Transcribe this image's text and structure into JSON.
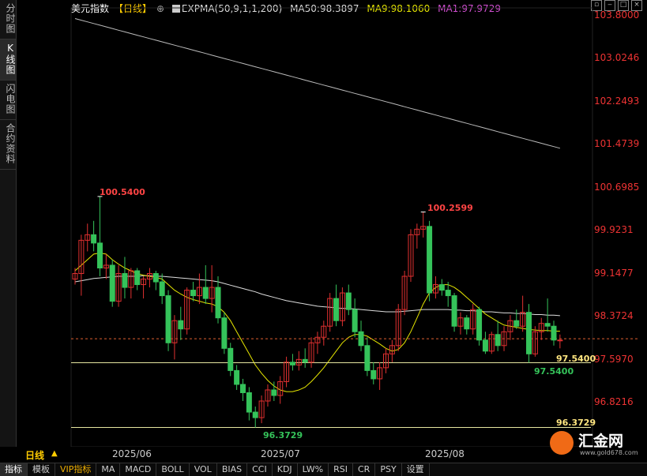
{
  "side_tabs": [
    "分时图",
    "K线图",
    "闪电图",
    "合约资料"
  ],
  "header": {
    "title": "美元指数",
    "period_tag": "【日线】",
    "plus_icon": "⊕",
    "expma": "EXPMA(50,9,1,1,200)",
    "ma50": "MA50:98.3897",
    "ma9": "MA9:98.1060",
    "ma1": "MA1:97.9729"
  },
  "window_buttons": [
    "restore-icon",
    "minimize-icon",
    "maximize-icon",
    "close-icon"
  ],
  "colors": {
    "up": "#e03030",
    "down": "#35c35a",
    "ma50": "#dddddd",
    "ma9": "#e6e600",
    "ma200": "#bbbbbb",
    "axis_text": "#e33333"
  },
  "chart_data": {
    "type": "candlestick",
    "y_ticks": [
      "103.8000",
      "103.0246",
      "102.2493",
      "101.4739",
      "100.6985",
      "99.9231",
      "99.1477",
      "98.3724",
      "97.5970",
      "96.8216"
    ],
    "ylim": [
      96.25,
      103.8
    ],
    "x_labels": [
      "2025/06",
      "2025/07",
      "2025/08"
    ],
    "period": "日线",
    "annotations": {
      "high1": "100.5400",
      "high2": "100.2599",
      "low_main": "96.3729",
      "low_main_right": "96.3729",
      "recent_low": "97.5400",
      "recent_low_right": "97.5400"
    },
    "candles": [
      {
        "o": 99.05,
        "h": 99.25,
        "l": 98.95,
        "c": 99.15
      },
      {
        "o": 99.15,
        "h": 99.85,
        "l": 98.75,
        "c": 99.75
      },
      {
        "o": 99.75,
        "h": 100.05,
        "l": 99.55,
        "c": 99.85
      },
      {
        "o": 99.85,
        "h": 100.1,
        "l": 99.55,
        "c": 99.7
      },
      {
        "o": 99.7,
        "h": 100.54,
        "l": 99.1,
        "c": 99.25
      },
      {
        "o": 99.25,
        "h": 99.5,
        "l": 99.05,
        "c": 99.3
      },
      {
        "o": 99.3,
        "h": 99.4,
        "l": 98.55,
        "c": 98.65
      },
      {
        "o": 98.65,
        "h": 99.3,
        "l": 98.55,
        "c": 99.15
      },
      {
        "o": 99.15,
        "h": 99.45,
        "l": 98.7,
        "c": 98.9
      },
      {
        "o": 98.9,
        "h": 99.25,
        "l": 98.7,
        "c": 99.2
      },
      {
        "o": 99.2,
        "h": 99.25,
        "l": 98.85,
        "c": 98.95
      },
      {
        "o": 98.95,
        "h": 99.1,
        "l": 98.7,
        "c": 99.05
      },
      {
        "o": 99.05,
        "h": 99.25,
        "l": 98.9,
        "c": 99.15
      },
      {
        "o": 99.15,
        "h": 99.2,
        "l": 98.85,
        "c": 99.0
      },
      {
        "o": 99.0,
        "h": 99.15,
        "l": 98.6,
        "c": 98.75
      },
      {
        "o": 98.75,
        "h": 98.85,
        "l": 97.75,
        "c": 97.9
      },
      {
        "o": 97.9,
        "h": 98.4,
        "l": 97.6,
        "c": 98.3
      },
      {
        "o": 98.3,
        "h": 98.55,
        "l": 97.95,
        "c": 98.15
      },
      {
        "o": 98.15,
        "h": 98.9,
        "l": 98.05,
        "c": 98.85
      },
      {
        "o": 98.85,
        "h": 99.0,
        "l": 98.65,
        "c": 98.75
      },
      {
        "o": 98.75,
        "h": 99.15,
        "l": 98.6,
        "c": 98.9
      },
      {
        "o": 98.9,
        "h": 99.3,
        "l": 98.6,
        "c": 98.7
      },
      {
        "o": 98.7,
        "h": 99.3,
        "l": 98.45,
        "c": 98.9
      },
      {
        "o": 98.9,
        "h": 99.1,
        "l": 98.25,
        "c": 98.35
      },
      {
        "o": 98.35,
        "h": 98.45,
        "l": 97.7,
        "c": 97.8
      },
      {
        "o": 97.8,
        "h": 97.9,
        "l": 97.3,
        "c": 97.4
      },
      {
        "o": 97.4,
        "h": 97.5,
        "l": 97.05,
        "c": 97.15
      },
      {
        "o": 97.15,
        "h": 97.25,
        "l": 96.85,
        "c": 97.0
      },
      {
        "o": 97.0,
        "h": 97.1,
        "l": 96.5,
        "c": 96.65
      },
      {
        "o": 96.65,
        "h": 96.75,
        "l": 96.37,
        "c": 96.55
      },
      {
        "o": 96.55,
        "h": 96.95,
        "l": 96.45,
        "c": 96.85
      },
      {
        "o": 96.85,
        "h": 97.15,
        "l": 96.75,
        "c": 97.05
      },
      {
        "o": 97.05,
        "h": 97.2,
        "l": 96.85,
        "c": 96.95
      },
      {
        "o": 96.95,
        "h": 97.3,
        "l": 96.8,
        "c": 97.2
      },
      {
        "o": 97.2,
        "h": 97.65,
        "l": 97.1,
        "c": 97.55
      },
      {
        "o": 97.55,
        "h": 97.7,
        "l": 97.4,
        "c": 97.5
      },
      {
        "o": 97.5,
        "h": 97.75,
        "l": 97.4,
        "c": 97.6
      },
      {
        "o": 97.6,
        "h": 97.8,
        "l": 97.45,
        "c": 97.55
      },
      {
        "o": 97.55,
        "h": 98.0,
        "l": 97.45,
        "c": 97.9
      },
      {
        "o": 97.9,
        "h": 98.1,
        "l": 97.7,
        "c": 98.0
      },
      {
        "o": 98.0,
        "h": 98.3,
        "l": 97.85,
        "c": 98.2
      },
      {
        "o": 98.2,
        "h": 98.8,
        "l": 98.1,
        "c": 98.7
      },
      {
        "o": 98.7,
        "h": 98.95,
        "l": 98.2,
        "c": 98.3
      },
      {
        "o": 98.3,
        "h": 98.9,
        "l": 98.2,
        "c": 98.8
      },
      {
        "o": 98.8,
        "h": 98.95,
        "l": 98.4,
        "c": 98.5
      },
      {
        "o": 98.5,
        "h": 98.7,
        "l": 98.0,
        "c": 98.1
      },
      {
        "o": 98.1,
        "h": 98.3,
        "l": 97.75,
        "c": 97.85
      },
      {
        "o": 97.85,
        "h": 98.0,
        "l": 97.3,
        "c": 97.4
      },
      {
        "o": 97.4,
        "h": 97.55,
        "l": 97.15,
        "c": 97.25
      },
      {
        "o": 97.25,
        "h": 97.55,
        "l": 97.05,
        "c": 97.45
      },
      {
        "o": 97.45,
        "h": 97.8,
        "l": 97.35,
        "c": 97.7
      },
      {
        "o": 97.7,
        "h": 97.95,
        "l": 97.55,
        "c": 97.85
      },
      {
        "o": 97.85,
        "h": 98.6,
        "l": 97.75,
        "c": 98.5
      },
      {
        "o": 98.5,
        "h": 99.2,
        "l": 98.4,
        "c": 99.1
      },
      {
        "o": 99.1,
        "h": 99.95,
        "l": 99.0,
        "c": 99.85
      },
      {
        "o": 99.85,
        "h": 100.05,
        "l": 99.6,
        "c": 99.95
      },
      {
        "o": 99.95,
        "h": 100.26,
        "l": 99.8,
        "c": 100.0
      },
      {
        "o": 100.0,
        "h": 100.1,
        "l": 98.65,
        "c": 98.8
      },
      {
        "o": 98.8,
        "h": 99.1,
        "l": 98.7,
        "c": 98.95
      },
      {
        "o": 98.95,
        "h": 99.05,
        "l": 98.75,
        "c": 98.85
      },
      {
        "o": 98.85,
        "h": 99.0,
        "l": 98.55,
        "c": 98.75
      },
      {
        "o": 98.75,
        "h": 98.8,
        "l": 98.1,
        "c": 98.2
      },
      {
        "o": 98.2,
        "h": 98.45,
        "l": 98.05,
        "c": 98.35
      },
      {
        "o": 98.35,
        "h": 98.4,
        "l": 98.05,
        "c": 98.15
      },
      {
        "o": 98.15,
        "h": 98.6,
        "l": 98.05,
        "c": 98.5
      },
      {
        "o": 98.5,
        "h": 98.55,
        "l": 97.85,
        "c": 97.95
      },
      {
        "o": 97.95,
        "h": 98.1,
        "l": 97.7,
        "c": 97.75
      },
      {
        "o": 97.75,
        "h": 98.1,
        "l": 97.7,
        "c": 98.05
      },
      {
        "o": 98.05,
        "h": 98.3,
        "l": 97.75,
        "c": 97.85
      },
      {
        "o": 97.85,
        "h": 98.2,
        "l": 97.75,
        "c": 98.1
      },
      {
        "o": 98.1,
        "h": 98.4,
        "l": 97.95,
        "c": 98.3
      },
      {
        "o": 98.3,
        "h": 98.5,
        "l": 98.15,
        "c": 98.2
      },
      {
        "o": 98.2,
        "h": 98.75,
        "l": 98.1,
        "c": 98.45
      },
      {
        "o": 98.45,
        "h": 98.6,
        "l": 97.54,
        "c": 97.7
      },
      {
        "o": 97.7,
        "h": 98.2,
        "l": 97.65,
        "c": 98.1
      },
      {
        "o": 98.1,
        "h": 98.35,
        "l": 97.95,
        "c": 98.25
      },
      {
        "o": 98.25,
        "h": 98.7,
        "l": 98.1,
        "c": 98.2
      },
      {
        "o": 98.2,
        "h": 98.3,
        "l": 97.85,
        "c": 97.95
      },
      {
        "o": 97.95,
        "h": 98.05,
        "l": 97.8,
        "c": 97.95
      }
    ],
    "ma50": [
      99.0,
      99.02,
      99.04,
      99.06,
      99.07,
      99.08,
      99.09,
      99.1,
      99.1,
      99.1,
      99.1,
      99.11,
      99.11,
      99.1,
      99.1,
      99.09,
      99.08,
      99.07,
      99.06,
      99.05,
      99.04,
      99.03,
      99.02,
      99.0,
      98.97,
      98.94,
      98.91,
      98.88,
      98.85,
      98.82,
      98.78,
      98.75,
      98.72,
      98.69,
      98.66,
      98.64,
      98.62,
      98.6,
      98.58,
      98.56,
      98.55,
      98.54,
      98.53,
      98.52,
      98.52,
      98.51,
      98.5,
      98.49,
      98.48,
      98.47,
      98.46,
      98.46,
      98.46,
      98.47,
      98.48,
      98.49,
      98.5,
      98.5,
      98.5,
      98.5,
      98.5,
      98.49,
      98.49,
      98.48,
      98.48,
      98.47,
      98.46,
      98.46,
      98.45,
      98.44,
      98.44,
      98.43,
      98.43,
      98.42,
      98.41,
      98.41,
      98.4,
      98.4,
      98.39
    ],
    "ma9": [
      99.2,
      99.3,
      99.4,
      99.5,
      99.52,
      99.5,
      99.4,
      99.32,
      99.25,
      99.2,
      99.15,
      99.12,
      99.1,
      99.08,
      99.05,
      98.95,
      98.85,
      98.78,
      98.72,
      98.68,
      98.65,
      98.62,
      98.6,
      98.55,
      98.45,
      98.3,
      98.1,
      97.9,
      97.7,
      97.5,
      97.35,
      97.22,
      97.12,
      97.05,
      97.02,
      97.02,
      97.05,
      97.1,
      97.2,
      97.32,
      97.45,
      97.6,
      97.75,
      97.9,
      98.0,
      98.05,
      98.05,
      98.02,
      97.95,
      97.88,
      97.8,
      97.75,
      97.78,
      97.9,
      98.1,
      98.35,
      98.6,
      98.8,
      98.9,
      98.95,
      98.95,
      98.9,
      98.82,
      98.72,
      98.62,
      98.52,
      98.42,
      98.35,
      98.28,
      98.22,
      98.2,
      98.18,
      98.16,
      98.14,
      98.13,
      98.12,
      98.12,
      98.11,
      98.11
    ],
    "ma200": [
      103.75,
      103.72,
      103.69,
      103.66,
      103.63,
      103.6,
      103.57,
      103.54,
      103.51,
      103.48,
      103.45,
      103.42,
      103.39,
      103.36,
      103.33,
      103.3,
      103.27,
      103.24,
      103.21,
      103.18,
      103.15,
      103.12,
      103.09,
      103.06,
      103.03,
      103.0,
      102.97,
      102.94,
      102.91,
      102.88,
      102.85,
      102.82,
      102.79,
      102.76,
      102.73,
      102.7,
      102.67,
      102.64,
      102.61,
      102.58,
      102.55,
      102.52,
      102.49,
      102.46,
      102.43,
      102.4,
      102.37,
      102.34,
      102.31,
      102.28,
      102.25,
      102.22,
      102.19,
      102.16,
      102.13,
      102.1,
      102.07,
      102.04,
      102.01,
      101.98,
      101.95,
      101.92,
      101.89,
      101.86,
      101.83,
      101.8,
      101.77,
      101.74,
      101.71,
      101.68,
      101.65,
      101.62,
      101.59,
      101.56,
      101.53,
      101.5,
      101.47,
      101.44,
      101.41
    ]
  },
  "bottom_tabs": [
    "指标",
    "模板",
    "VIP指标",
    "MA",
    "MACD",
    "BOLL",
    "VOL",
    "BIAS",
    "CCI",
    "KDJ",
    "LW%",
    "RSI",
    "CR",
    "PSY",
    "设置"
  ],
  "logo": {
    "text": "汇金网",
    "url": "www.gold678.com"
  }
}
